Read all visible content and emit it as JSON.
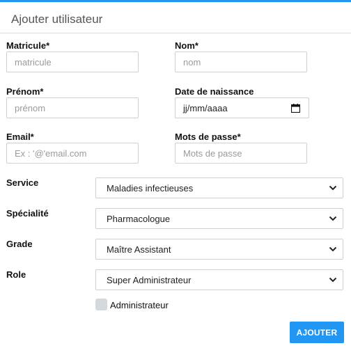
{
  "header": {
    "title": "Ajouter utilisateur"
  },
  "colors": {
    "accent": "#2196f3",
    "checkbox": "#d4d9de"
  },
  "form": {
    "matricule": {
      "label": "Matricule*",
      "placeholder": "matricule",
      "value": ""
    },
    "nom": {
      "label": "Nom*",
      "placeholder": "nom",
      "value": ""
    },
    "prenom": {
      "label": "Prénom*",
      "placeholder": "prénom",
      "value": ""
    },
    "date_naissance": {
      "label": "Date de naissance",
      "display": "jj/mm/aaaa",
      "icon": "calendar-icon"
    },
    "email": {
      "label": "Email*",
      "placeholder": "Ex : '@'email.com",
      "value": ""
    },
    "mot_de_passe": {
      "label": "Mots de passe*",
      "placeholder": "Mots de passe",
      "value": ""
    },
    "service": {
      "label": "Service",
      "selected": "Maladies infectieuses"
    },
    "specialite": {
      "label": "Spécialité",
      "selected": "Pharmacologue"
    },
    "grade": {
      "label": "Grade",
      "selected": "Maître Assistant"
    },
    "role": {
      "label": "Role",
      "selected": "Super Administrateur"
    },
    "administrateur": {
      "label": "Administrateur",
      "checked": false
    },
    "submit_label": "AJOUTER"
  }
}
